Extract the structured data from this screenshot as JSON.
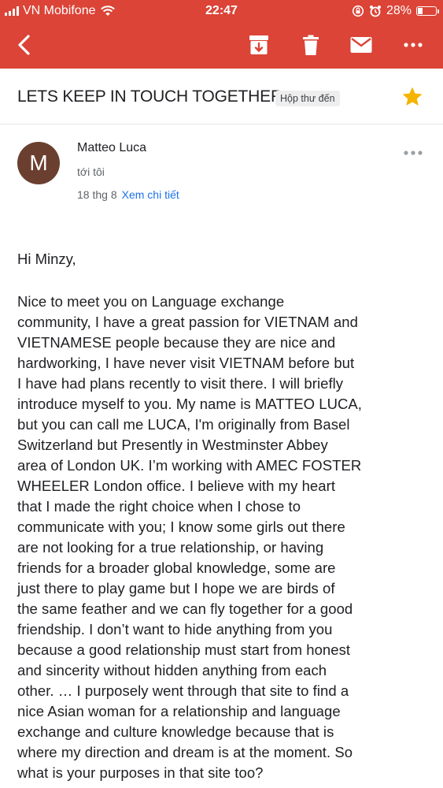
{
  "status_bar": {
    "carrier": "VN Mobifone",
    "time": "22:47",
    "battery": "28%",
    "battery_level": 0.28
  },
  "toolbar": {
    "icons": [
      "back-arrow-icon",
      "archive-icon",
      "trash-icon",
      "mail-icon",
      "more-horizontal-icon"
    ]
  },
  "email": {
    "subject": "LETS KEEP IN TOUCH TOGETHER",
    "label": "Hộp thư đến",
    "starred": true,
    "star_color": "#f4b400",
    "sender": {
      "initial": "M",
      "name": "Matteo Luca",
      "avatar_color": "#6b3f2f"
    },
    "recipient": "tới tôi",
    "date": "18 thg 8",
    "details_link": "Xem chi tiết",
    "greeting": "Hi Minzy,",
    "body_lines": [
      "Nice to meet you on Language exchange",
      "community, I have a great passion for VIETNAM and",
      "VIETNAMESE people because they are nice and",
      "hardworking, I have never visit VIETNAM before but",
      "I have had plans recently to visit there.  I will briefly",
      "introduce myself to you. My name is MATTEO LUCA,",
      "but you can call me LUCA, I'm originally from Basel",
      "Switzerland but Presently in Westminster Abbey",
      "area of London UK. I’m working with AMEC FOSTER",
      "WHEELER London office. I believe with my heart",
      "that I made the right choice when I chose to",
      "communicate with you; I know some girls out there",
      "are not looking for a true relationship, or having",
      "friends for a broader global knowledge, some are",
      "just there to play game but I hope we are birds of",
      "the same feather and we can fly together for a good",
      "friendship. I don’t want to hide anything from you",
      "because a good relationship must start from honest",
      "and sincerity without hidden anything from each",
      "other. … I purposely went through that site to find a",
      "nice Asian woman for a relationship and language",
      "exchange and culture knowledge because that is",
      "where my direction and dream is at the moment. So",
      "what is your purposes in that site too?"
    ]
  },
  "colors": {
    "header_red": "#db4437",
    "link_blue": "#1a73e8"
  }
}
